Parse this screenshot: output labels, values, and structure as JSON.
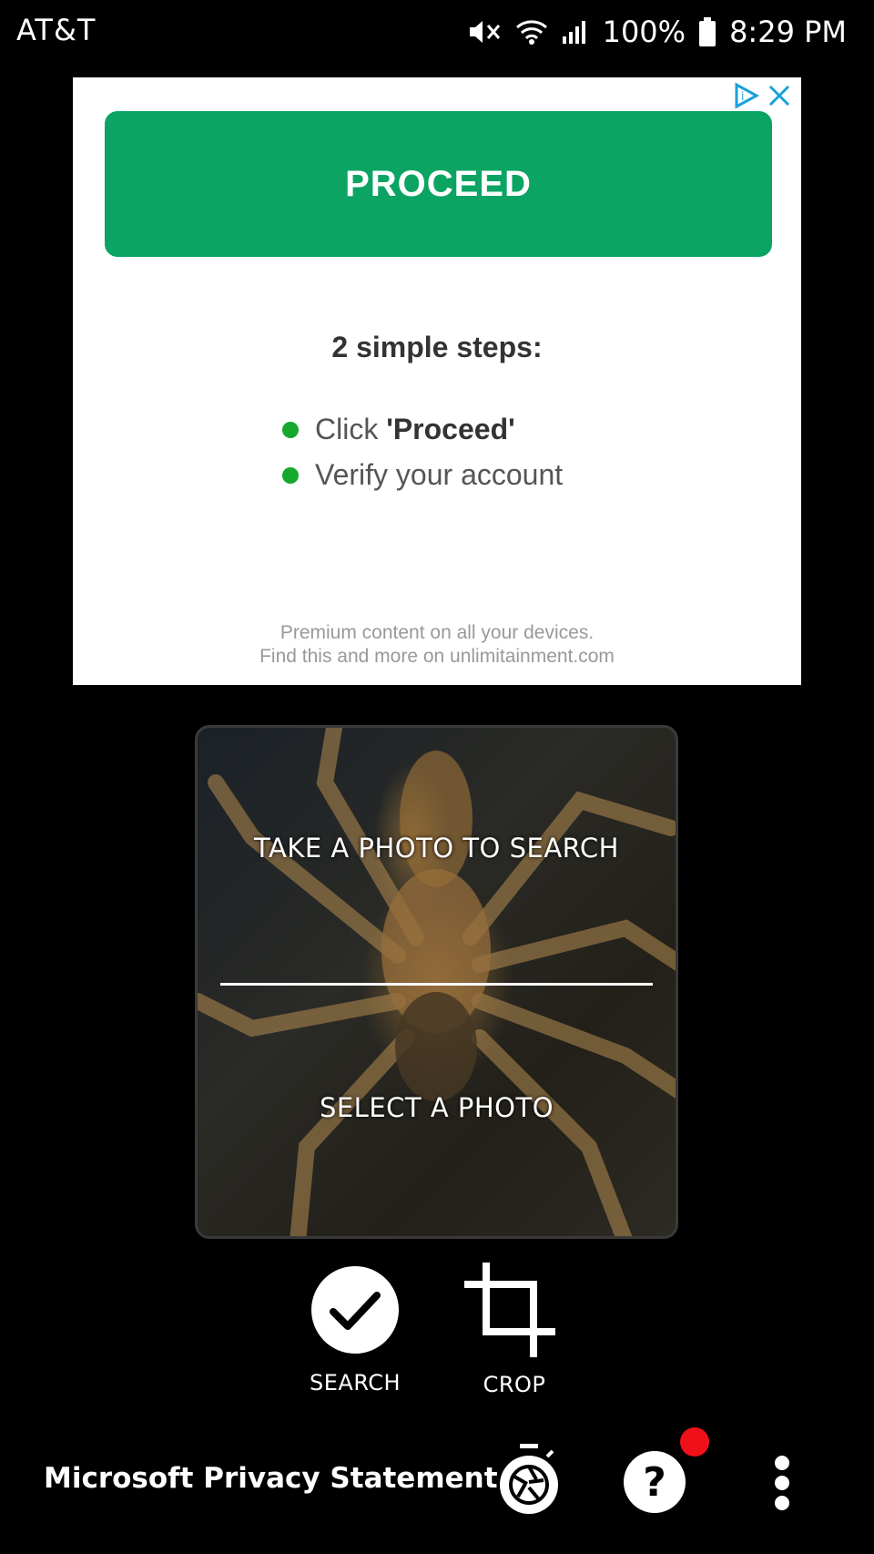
{
  "status_bar": {
    "carrier": "AT&T",
    "battery_percent": "100%",
    "time": "8:29 PM"
  },
  "ad": {
    "proceed_label": "PROCEED",
    "steps_title": "2 simple steps:",
    "step1_prefix": "Click ",
    "step1_bold": "'Proceed'",
    "step2": "Verify your account",
    "footer_line1": "Premium content on all your devices.",
    "footer_line2": "Find this and more on unlimitainment.com",
    "accent_color": "#0ca463"
  },
  "panel": {
    "take_photo_label": "TAKE A PHOTO TO SEARCH",
    "select_photo_label": "SELECT A PHOTO"
  },
  "actions": {
    "search_label": "SEARCH",
    "crop_label": "CROP"
  },
  "bottom_bar": {
    "privacy_label": "Microsoft Privacy Statement",
    "icons": [
      "shutter-timer-icon",
      "help-icon",
      "more-vert-icon"
    ],
    "notification_color": "#f0101a"
  }
}
